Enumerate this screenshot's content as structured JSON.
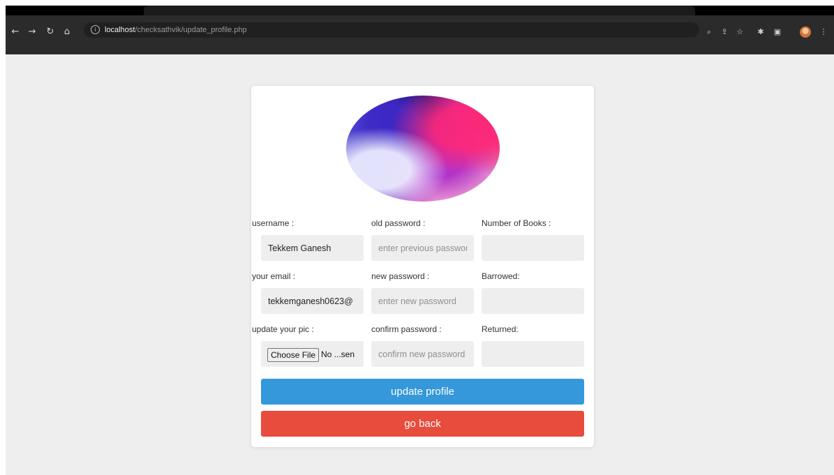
{
  "browser": {
    "url_host": "localhost",
    "url_path": "/checksathvik/update_profile.php",
    "nav_icons": [
      "back-arrow-icon",
      "forward-arrow-icon",
      "reload-icon",
      "home-icon"
    ],
    "toolbar_icons": [
      "zoom-icon",
      "share-icon",
      "star-icon",
      "extensions-icon",
      "sidepanel-icon",
      "profile-avatar-icon",
      "menu-icon"
    ]
  },
  "form": {
    "profile_image_alt": "profile picture",
    "fields": {
      "username": {
        "label": "username :",
        "value": "Tekkem Ganesh"
      },
      "old_password": {
        "label": "old password :",
        "placeholder": "enter previous password"
      },
      "num_books": {
        "label": "Number of Books :",
        "value": ""
      },
      "email": {
        "label": "your email :",
        "value": "tekkemganesh0623@"
      },
      "new_password": {
        "label": "new password :",
        "placeholder": "enter new password"
      },
      "borrowed": {
        "label": "Barrowed:",
        "value": ""
      },
      "pic": {
        "label": "update your pic :",
        "button": "Choose File",
        "status": "No ...sen"
      },
      "confirm_password": {
        "label": "confirm password :",
        "placeholder": "confirm new password"
      },
      "returned": {
        "label": "Returned:",
        "value": ""
      }
    },
    "buttons": {
      "update": "update profile",
      "back": "go back"
    }
  },
  "colors": {
    "page_bg": "#eeeeee",
    "update_btn": "#3498db",
    "back_btn": "#e74c3c",
    "input_bg": "#eeeeee"
  }
}
